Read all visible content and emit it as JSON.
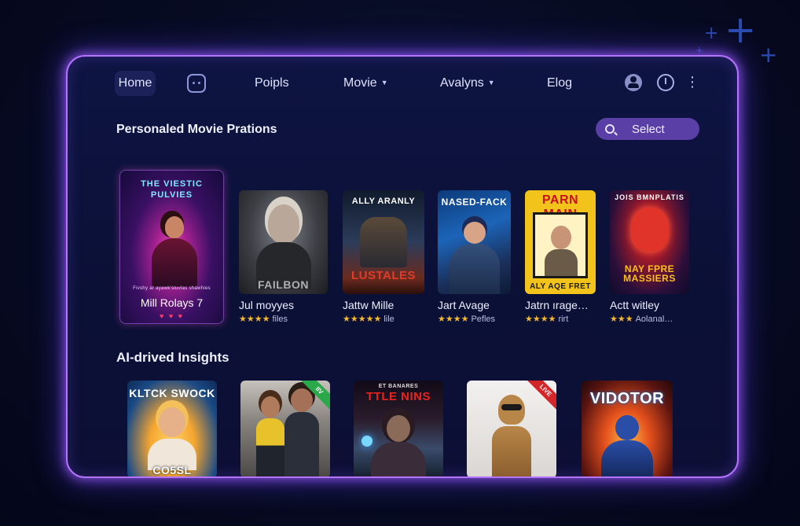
{
  "nav": {
    "home": "Home",
    "item2": "Poipls",
    "item3": "Movie",
    "item4": "Avalyns",
    "item5": "Elog"
  },
  "sections": {
    "personalized": "Personaled Movie Prations",
    "insights": "AI-drived Insights"
  },
  "search": {
    "label": "Select"
  },
  "featured": {
    "poster_title_line1": "THE VIESTIC",
    "poster_title_line2": "PULVIES",
    "tagline": "Fivshy ar ayawk'sluvlas shawhies",
    "title": "Mill Rolays 7",
    "hearts": "♥ ♥ ♥"
  },
  "row1": [
    {
      "poster_text": "FAILBON",
      "title": "Jul moyyes",
      "stars": "★★★★",
      "rating_text": "files"
    },
    {
      "poster_text_top": "ALLY ARANLY",
      "poster_text_bottom": "LUSTALES",
      "title": "Jattw Mille",
      "stars": "★★★★★",
      "rating_text": "lile"
    },
    {
      "poster_text": "NASED-FACK",
      "title": "Jart Avage",
      "stars": "★★★★",
      "rating_text": "Pefles"
    },
    {
      "poster_text_top": "PARN MAIN",
      "poster_text_bottom": "ALY AQE FRET",
      "title": "Jatrn ırage…",
      "stars": "★★★★",
      "rating_text": "rirt"
    },
    {
      "poster_text_top": "JOIS BMNPLATIS",
      "poster_text_bottom": "NAY FPRE MASSIERS",
      "title": "Actt witley",
      "stars": "★★★",
      "rating_text": "Aolanal…"
    }
  ],
  "row2": [
    {
      "poster_text_top": "KLTCK SWOCK",
      "poster_text_bottom": "CO5SL"
    },
    {
      "poster_text": "",
      "ribbon": "IIV"
    },
    {
      "poster_text_top": "TTLE NINS",
      "poster_text_small": "ET BANARES"
    },
    {
      "poster_text": "",
      "ribbon": "LIVE"
    },
    {
      "poster_text_top": "VIDOTOR"
    }
  ],
  "colors": {
    "accent": "#b574ff",
    "search_bg": "#5a3fa6",
    "star": "#f5b82e"
  }
}
